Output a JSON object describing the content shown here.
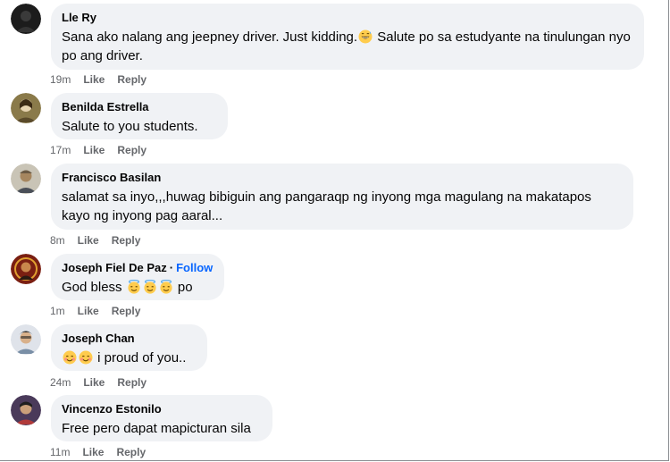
{
  "comments": [
    {
      "author": "Lle Ry",
      "text_parts": [
        "Sana ako nalang ang jeepney driver. Just kidding.",
        " Salute po sa estudyante na tinulungan nyo po ang driver."
      ],
      "emoji": [
        "grinning-sweat-emoji"
      ],
      "time": "19m",
      "like": "Like",
      "reply": "Reply"
    },
    {
      "author": "Benilda Estrella",
      "text": "Salute to you students.",
      "time": "17m",
      "like": "Like",
      "reply": "Reply"
    },
    {
      "author": "Francisco Basilan",
      "text": "salamat sa inyo,,,huwag bibiguin ang pangaraqp ng inyong mga magulang na makatapos kayo ng inyong pag aaral...",
      "time": "8m",
      "like": "Like",
      "reply": "Reply"
    },
    {
      "author": "Joseph Fiel De Paz",
      "follow_sep": "·",
      "follow": "Follow",
      "text_parts": [
        "God bless ",
        " po"
      ],
      "emoji": [
        "smiling-halo-emoji",
        "smiling-halo-emoji",
        "smiling-halo-emoji"
      ],
      "time": "1m",
      "like": "Like",
      "reply": "Reply"
    },
    {
      "author": "Joseph Chan",
      "text_parts": [
        "",
        " i proud of you.."
      ],
      "emoji": [
        "smiling-blush-emoji",
        "smiling-blush-emoji"
      ],
      "time": "24m",
      "like": "Like",
      "reply": "Reply"
    },
    {
      "author": "Vincenzo Estonilo",
      "text": "Free pero dapat mapicturan sila",
      "time": "11m",
      "like": "Like",
      "reply": "Reply"
    }
  ],
  "colors": {
    "bubble_bg": "#f0f2f5",
    "text": "#050505",
    "meta": "#65676b",
    "follow": "#0866ff",
    "emoji_face": "#ffcc4d"
  }
}
